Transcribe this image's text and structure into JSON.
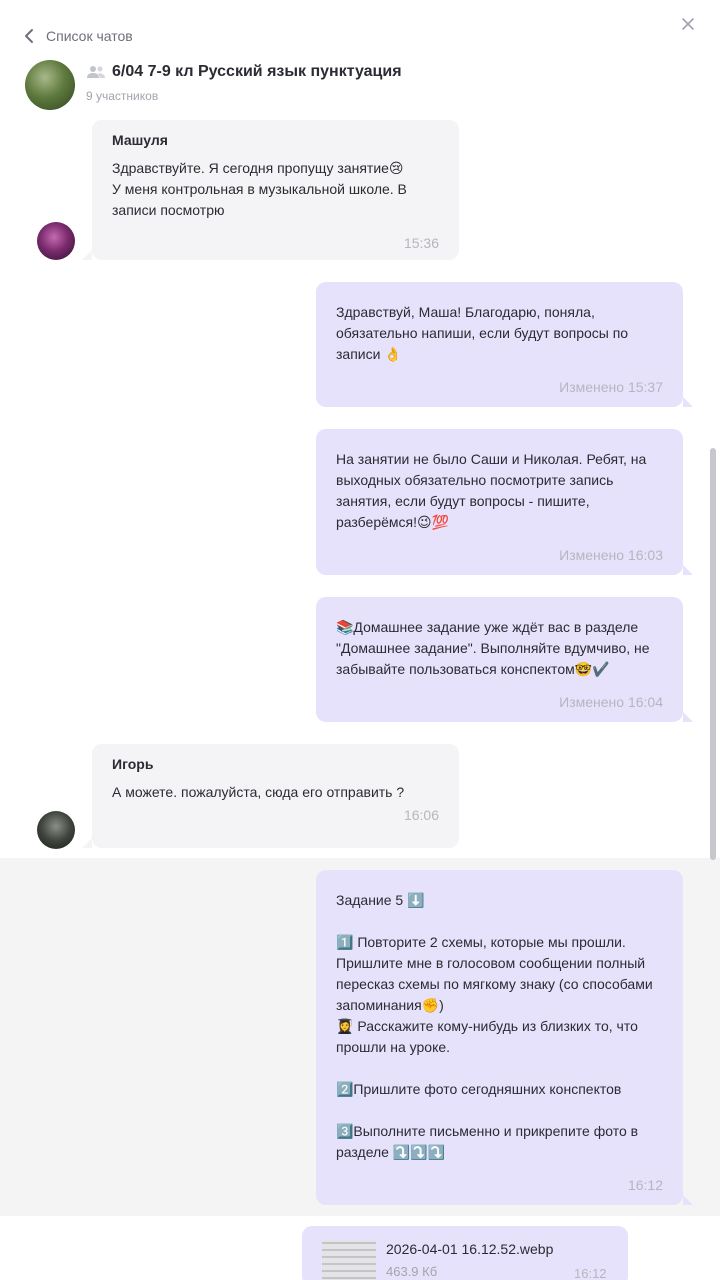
{
  "header": {
    "back_label": "Список чатов",
    "chat_title": "6/04 7-9 кл Русский язык пунктуация",
    "participants": "9 участников"
  },
  "messages": [
    {
      "sender": "Машуля",
      "text": "Здравствуйте. Я сегодня пропущу занятие😢\nУ меня контрольная в музыкальной школе. В записи посмотрю",
      "time": "15:36"
    },
    {
      "text": "Здравствуй, Маша! Благодарю, поняла, обязательно напиши, если будут вопросы по записи 👌",
      "time": "Изменено 15:37"
    },
    {
      "text": "На занятии не было Саши и Николая. Ребят, на выходных обязательно посмотрите запись занятия, если будут вопросы - пишите, разберёмся!😉💯",
      "time": "Изменено 16:03"
    },
    {
      "text": "📚Домашнее задание уже ждёт вас в разделе \"Домашнее задание\". Выполняйте вдумчиво, не забывайте пользоваться конспектом🤓✔️",
      "time": "Изменено 16:04"
    },
    {
      "sender": "Игорь",
      "text": "А можете. пожалуйста, сюда его отправить ?",
      "time": "16:06"
    },
    {
      "text": "Задание 5 ⬇️\n\n1️⃣ Повторите 2 схемы, которые мы прошли. Пришлите мне в голосовом сообщении полный пересказ схемы по мягкому знаку (со способами запоминания✊)\n👩‍🎓 Расскажите кому-нибудь из близких то, что прошли на уроке.\n\n2️⃣Пришлите фото сегодняшних конспектов\n\n3️⃣Выполните письменно и прикрепите фото в разделе ⤵️⤵️⤵️",
      "time": "16:12"
    }
  ],
  "file": {
    "name": "2026-04-01 16.12.52.webp",
    "size": "463.9 Кб",
    "time": "16:12"
  }
}
